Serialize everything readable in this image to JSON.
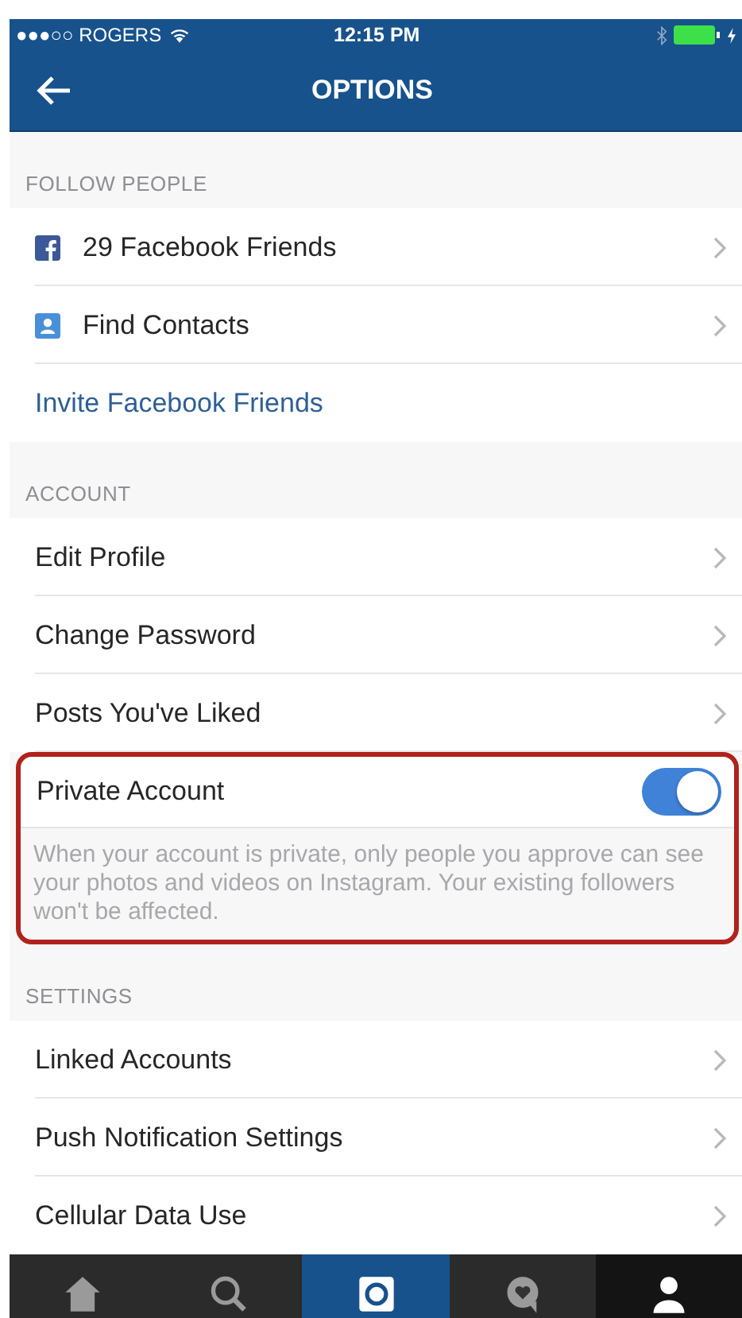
{
  "status_bar": {
    "carrier": "●●●○○ ROGERS",
    "time": "12:15 PM"
  },
  "nav": {
    "title": "OPTIONS"
  },
  "sections": [
    {
      "header": "FOLLOW PEOPLE",
      "items": [
        {
          "kind": "facebook",
          "label": "29 Facebook Friends"
        },
        {
          "kind": "contacts",
          "label": "Find Contacts"
        },
        {
          "kind": "link",
          "label": "Invite Facebook Friends"
        }
      ]
    },
    {
      "header": "ACCOUNT",
      "items": [
        {
          "kind": "nav",
          "label": "Edit Profile"
        },
        {
          "kind": "nav",
          "label": "Change Password"
        },
        {
          "kind": "nav",
          "label": "Posts You've Liked"
        },
        {
          "kind": "toggle",
          "label": "Private Account",
          "on": true,
          "highlighted": true,
          "note": "When your account is private, only people you approve can see your photos and videos on Instagram. Your existing followers won't be affected."
        }
      ]
    },
    {
      "header": "SETTINGS",
      "items": [
        {
          "kind": "nav",
          "label": "Linked Accounts"
        },
        {
          "kind": "nav",
          "label": "Push Notification Settings"
        },
        {
          "kind": "nav",
          "label": "Cellular Data Use"
        }
      ]
    }
  ],
  "tab_bar": [
    {
      "kind": "home",
      "selected": false
    },
    {
      "kind": "search",
      "selected": false
    },
    {
      "kind": "camera",
      "selected": false
    },
    {
      "kind": "activity",
      "selected": false
    },
    {
      "kind": "profile",
      "selected": true
    }
  ]
}
